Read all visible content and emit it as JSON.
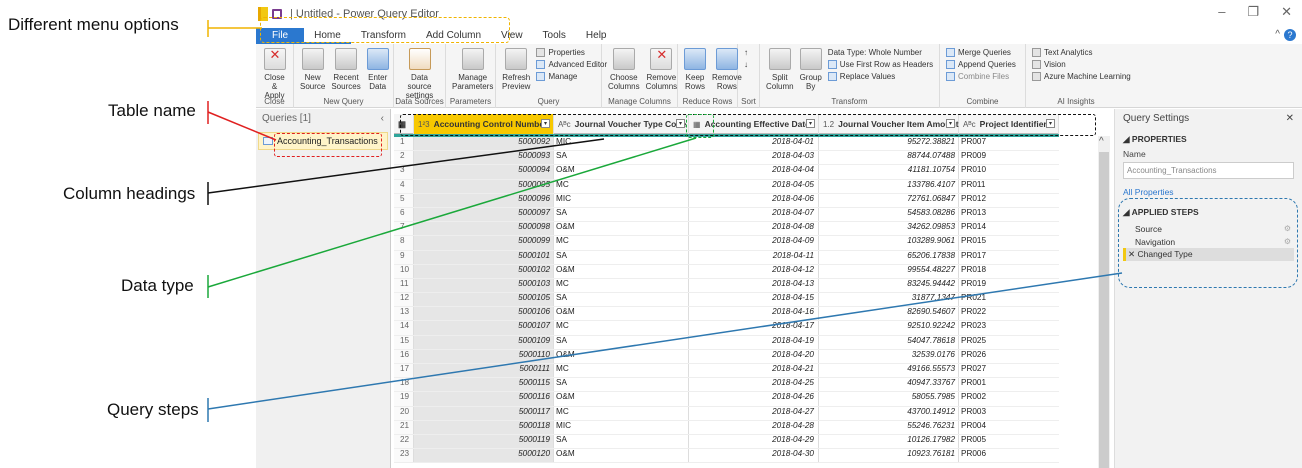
{
  "callouts": {
    "menu": "Different menu options",
    "table": "Table name",
    "columns": "Column headings",
    "datatype": "Data type",
    "steps": "Query steps"
  },
  "window": {
    "title": "| Untitled - Power Query Editor"
  },
  "tabs": [
    "File",
    "Home",
    "Transform",
    "Add Column",
    "View",
    "Tools",
    "Help"
  ],
  "ribbon": {
    "close": {
      "btn": "Close & Apply",
      "group": "Close"
    },
    "newquery": {
      "btns": [
        "New Source",
        "Recent Sources",
        "Enter Data"
      ],
      "group": "New Query"
    },
    "datasources": {
      "btn": "Data source settings",
      "group": "Data Sources"
    },
    "parameters": {
      "btn": "Manage Parameters",
      "group": "Parameters"
    },
    "query": {
      "refresh": "Refresh Preview",
      "properties": "Properties",
      "advanced": "Advanced Editor",
      "manage": "Manage",
      "group": "Query"
    },
    "managecols": {
      "btns": [
        "Choose Columns",
        "Remove Columns"
      ],
      "group": "Manage Columns"
    },
    "reducerows": {
      "btns": [
        "Keep Rows",
        "Remove Rows"
      ],
      "group": "Reduce Rows"
    },
    "sort": {
      "group": "Sort"
    },
    "transform": {
      "split": "Split Column",
      "groupby": "Group By",
      "datatype": "Data Type: Whole Number",
      "firstrow": "Use First Row as Headers",
      "replace": "Replace Values",
      "group": "Transform"
    },
    "combine": {
      "merge": "Merge Queries",
      "append": "Append Queries",
      "files": "Combine Files",
      "group": "Combine"
    },
    "ai": {
      "text": "Text Analytics",
      "vision": "Vision",
      "azure": "Azure Machine Learning",
      "group": "AI Insights"
    }
  },
  "queries": {
    "header": "Queries [1]",
    "items": [
      "Accounting_Transactions"
    ]
  },
  "columns": [
    {
      "type": "1²3",
      "name": "Accounting Control Number"
    },
    {
      "type": "Aᴮc",
      "name": "Journal Voucher Type Code"
    },
    {
      "type": "▦",
      "name": "Accounting Effective Date"
    },
    {
      "type": "1.2",
      "name": "Journal Voucher Item Amount"
    },
    {
      "type": "Aᴮc",
      "name": "Project Identifier"
    }
  ],
  "rows": [
    [
      "5000092",
      "MIC",
      "2018-04-01",
      "95272.38821",
      "PR007"
    ],
    [
      "5000093",
      "SA",
      "2018-04-03",
      "88744.07488",
      "PR009"
    ],
    [
      "5000094",
      "O&M",
      "2018-04-04",
      "41181.10754",
      "PR010"
    ],
    [
      "5000095",
      "MC",
      "2018-04-05",
      "133786.4107",
      "PR011"
    ],
    [
      "5000096",
      "MIC",
      "2018-04-06",
      "72761.06847",
      "PR012"
    ],
    [
      "5000097",
      "SA",
      "2018-04-07",
      "54583.08286",
      "PR013"
    ],
    [
      "5000098",
      "O&M",
      "2018-04-08",
      "34262.09853",
      "PR014"
    ],
    [
      "5000099",
      "MC",
      "2018-04-09",
      "103289.9061",
      "PR015"
    ],
    [
      "5000101",
      "SA",
      "2018-04-11",
      "65206.17838",
      "PR017"
    ],
    [
      "5000102",
      "O&M",
      "2018-04-12",
      "99554.48227",
      "PR018"
    ],
    [
      "5000103",
      "MC",
      "2018-04-13",
      "83245.94442",
      "PR019"
    ],
    [
      "5000105",
      "SA",
      "2018-04-15",
      "31877.1347",
      "PR021"
    ],
    [
      "5000106",
      "O&M",
      "2018-04-16",
      "82690.54607",
      "PR022"
    ],
    [
      "5000107",
      "MC",
      "2018-04-17",
      "92510.92242",
      "PR023"
    ],
    [
      "5000109",
      "SA",
      "2018-04-19",
      "54047.78618",
      "PR025"
    ],
    [
      "5000110",
      "O&M",
      "2018-04-20",
      "32539.0176",
      "PR026"
    ],
    [
      "5000111",
      "MC",
      "2018-04-21",
      "49166.55573",
      "PR027"
    ],
    [
      "5000115",
      "SA",
      "2018-04-25",
      "40947.33767",
      "PR001"
    ],
    [
      "5000116",
      "O&M",
      "2018-04-26",
      "58055.7985",
      "PR002"
    ],
    [
      "5000117",
      "MC",
      "2018-04-27",
      "43700.14912",
      "PR003"
    ],
    [
      "5000118",
      "MIC",
      "2018-04-28",
      "55246.76231",
      "PR004"
    ],
    [
      "5000119",
      "SA",
      "2018-04-29",
      "10126.17982",
      "PR005"
    ],
    [
      "5000120",
      "O&M",
      "2018-04-30",
      "10923.76181",
      "PR006"
    ]
  ],
  "settings": {
    "title": "Query Settings",
    "properties": "PROPERTIES",
    "name_label": "Name",
    "name_value": "Accounting_Transactions",
    "all_properties": "All Properties",
    "applied_steps": "APPLIED STEPS",
    "steps": [
      "Source",
      "Navigation",
      "Changed Type"
    ]
  },
  "colors": {
    "menu": "#f0b400",
    "table": "#e02020",
    "columns": "#111111",
    "datatype": "#1aa83a",
    "steps": "#2e78b0"
  }
}
